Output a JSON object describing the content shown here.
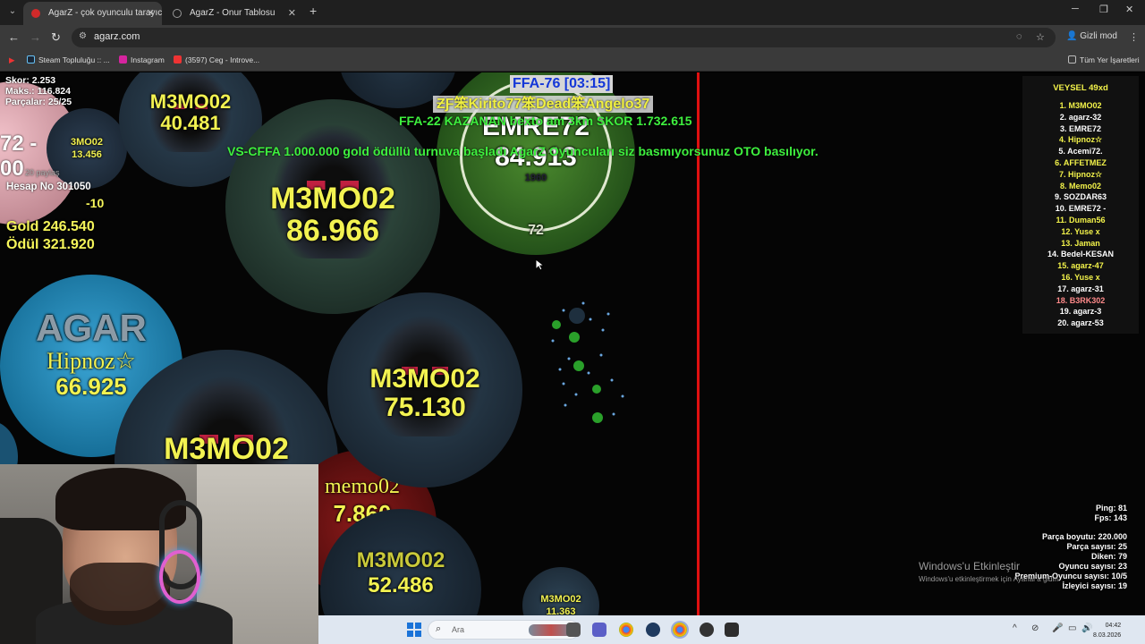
{
  "browser": {
    "tabs": [
      {
        "title": "AgarZ - çok oyunculu tarayıcı o",
        "active": true
      },
      {
        "title": "AgarZ - Onur Tablosu",
        "active": false
      }
    ],
    "url": "agarz.com",
    "incognito_label": "Gizli mod",
    "bookmarks": [
      "Steam Topluluğu :: ...",
      "Instagram",
      "(3597) Ceg - Introve..."
    ],
    "all_bookmarks_label": "Tüm Yer İşaretleri"
  },
  "hud": {
    "score": "Skor: 2.253",
    "max": "Maks.: 116.824",
    "parts": "Parçalar: 25/25",
    "share": "20 paylaş",
    "account": "Hesap No 301050",
    "gold": "Gold 246.540",
    "reward": "Ödül 321.920",
    "partial_big1": "72 -",
    "partial_big2": "00",
    "partial_small": "-10"
  },
  "banner": {
    "ffa_title": "FFA-76 [03:15]",
    "names": "ƵƑ笨Kirito77笨Dead笨Angelo37",
    "winner": "FFA-22 KAZANAN bexto am 3km SKOR 1.732.615",
    "announcement": "VS-CFFA 1.000.000 gold ödüllü turnuva başladı AgarZ Oyuncuları siz basmıyorsunuz OTO basılıyor."
  },
  "cells": {
    "c1": {
      "name": "M3MO02",
      "mass": "40.481"
    },
    "c2": {
      "name": "M3MO02",
      "mass": "86.966"
    },
    "c3": {
      "name": "EMRE72",
      "mass": "84.913",
      "badge_top": "1960",
      "badge_bottom": "72"
    },
    "c4": {
      "name": "Hipnoz☆",
      "mass": "66.925",
      "skin_text": "AGAR"
    },
    "c5": {
      "name": "M3MO02",
      "mass": "75.130"
    },
    "c6": {
      "name": "M3MO02"
    },
    "c7": {
      "name": "memo02",
      "mass": "7.860"
    },
    "c8": {
      "name": "M3MO02",
      "mass": "52.486"
    },
    "c9": {
      "name": "M3MO02",
      "mass": "11.363"
    },
    "c10": {
      "name": "3MO02",
      "mass": "13.456"
    }
  },
  "leaderboard": {
    "title": "VEYSEL 49xd",
    "rows": [
      {
        "text": "1. M3MO02",
        "color": "#f3f34a"
      },
      {
        "text": "2. agarz-32",
        "color": "#ffffff"
      },
      {
        "text": "3. EMRE72",
        "color": "#ffffff"
      },
      {
        "text": "4. Hipnoz☆",
        "color": "#f3f34a"
      },
      {
        "text": "5. Acemi72.",
        "color": "#ffffff"
      },
      {
        "text": "6. AFFETMEZ",
        "color": "#f3f34a"
      },
      {
        "text": "7. Hipnoz☆",
        "color": "#f3f34a"
      },
      {
        "text": "8. Memo02",
        "color": "#f3f34a"
      },
      {
        "text": "9. SOZDAR63",
        "color": "#ffffff"
      },
      {
        "text": "10. EMRE72 -",
        "color": "#ffffff"
      },
      {
        "text": "11. Duman56",
        "color": "#f3f34a"
      },
      {
        "text": "12. Yuse x",
        "color": "#f3f34a"
      },
      {
        "text": "13. Jaman",
        "color": "#f3f34a"
      },
      {
        "text": "14. Bedel-KESAN",
        "color": "#ffffff"
      },
      {
        "text": "15. agarz-47",
        "color": "#f3f34a"
      },
      {
        "text": "16. Yuse x",
        "color": "#f3f34a"
      },
      {
        "text": "17. agarz-31",
        "color": "#ffffff"
      },
      {
        "text": "18. B3RK302",
        "color": "#ff8a8a"
      },
      {
        "text": "19. agarz-3",
        "color": "#ffffff"
      },
      {
        "text": "20. agarz-53",
        "color": "#ffffff"
      }
    ]
  },
  "stats": {
    "ping": "Ping: 81",
    "fps": "Fps: 143",
    "part_size": "Parça boyutu: 220.000",
    "part_count": "Parça sayısı: 25",
    "spikes": "Diken: 79",
    "players": "Oyuncu sayısı: 23",
    "premium": "Premium-Oyuncu sayısı: 10/5",
    "spectators": "İzleyici sayısı: 19"
  },
  "watermark": {
    "line1": "Windows'u Etkinleştir",
    "line2": "Windows'u etkinleştirmek için Ayarlar'a gidin."
  },
  "taskbar": {
    "search_placeholder": "Ara",
    "time": "04:42",
    "date": "8.03.2026"
  }
}
